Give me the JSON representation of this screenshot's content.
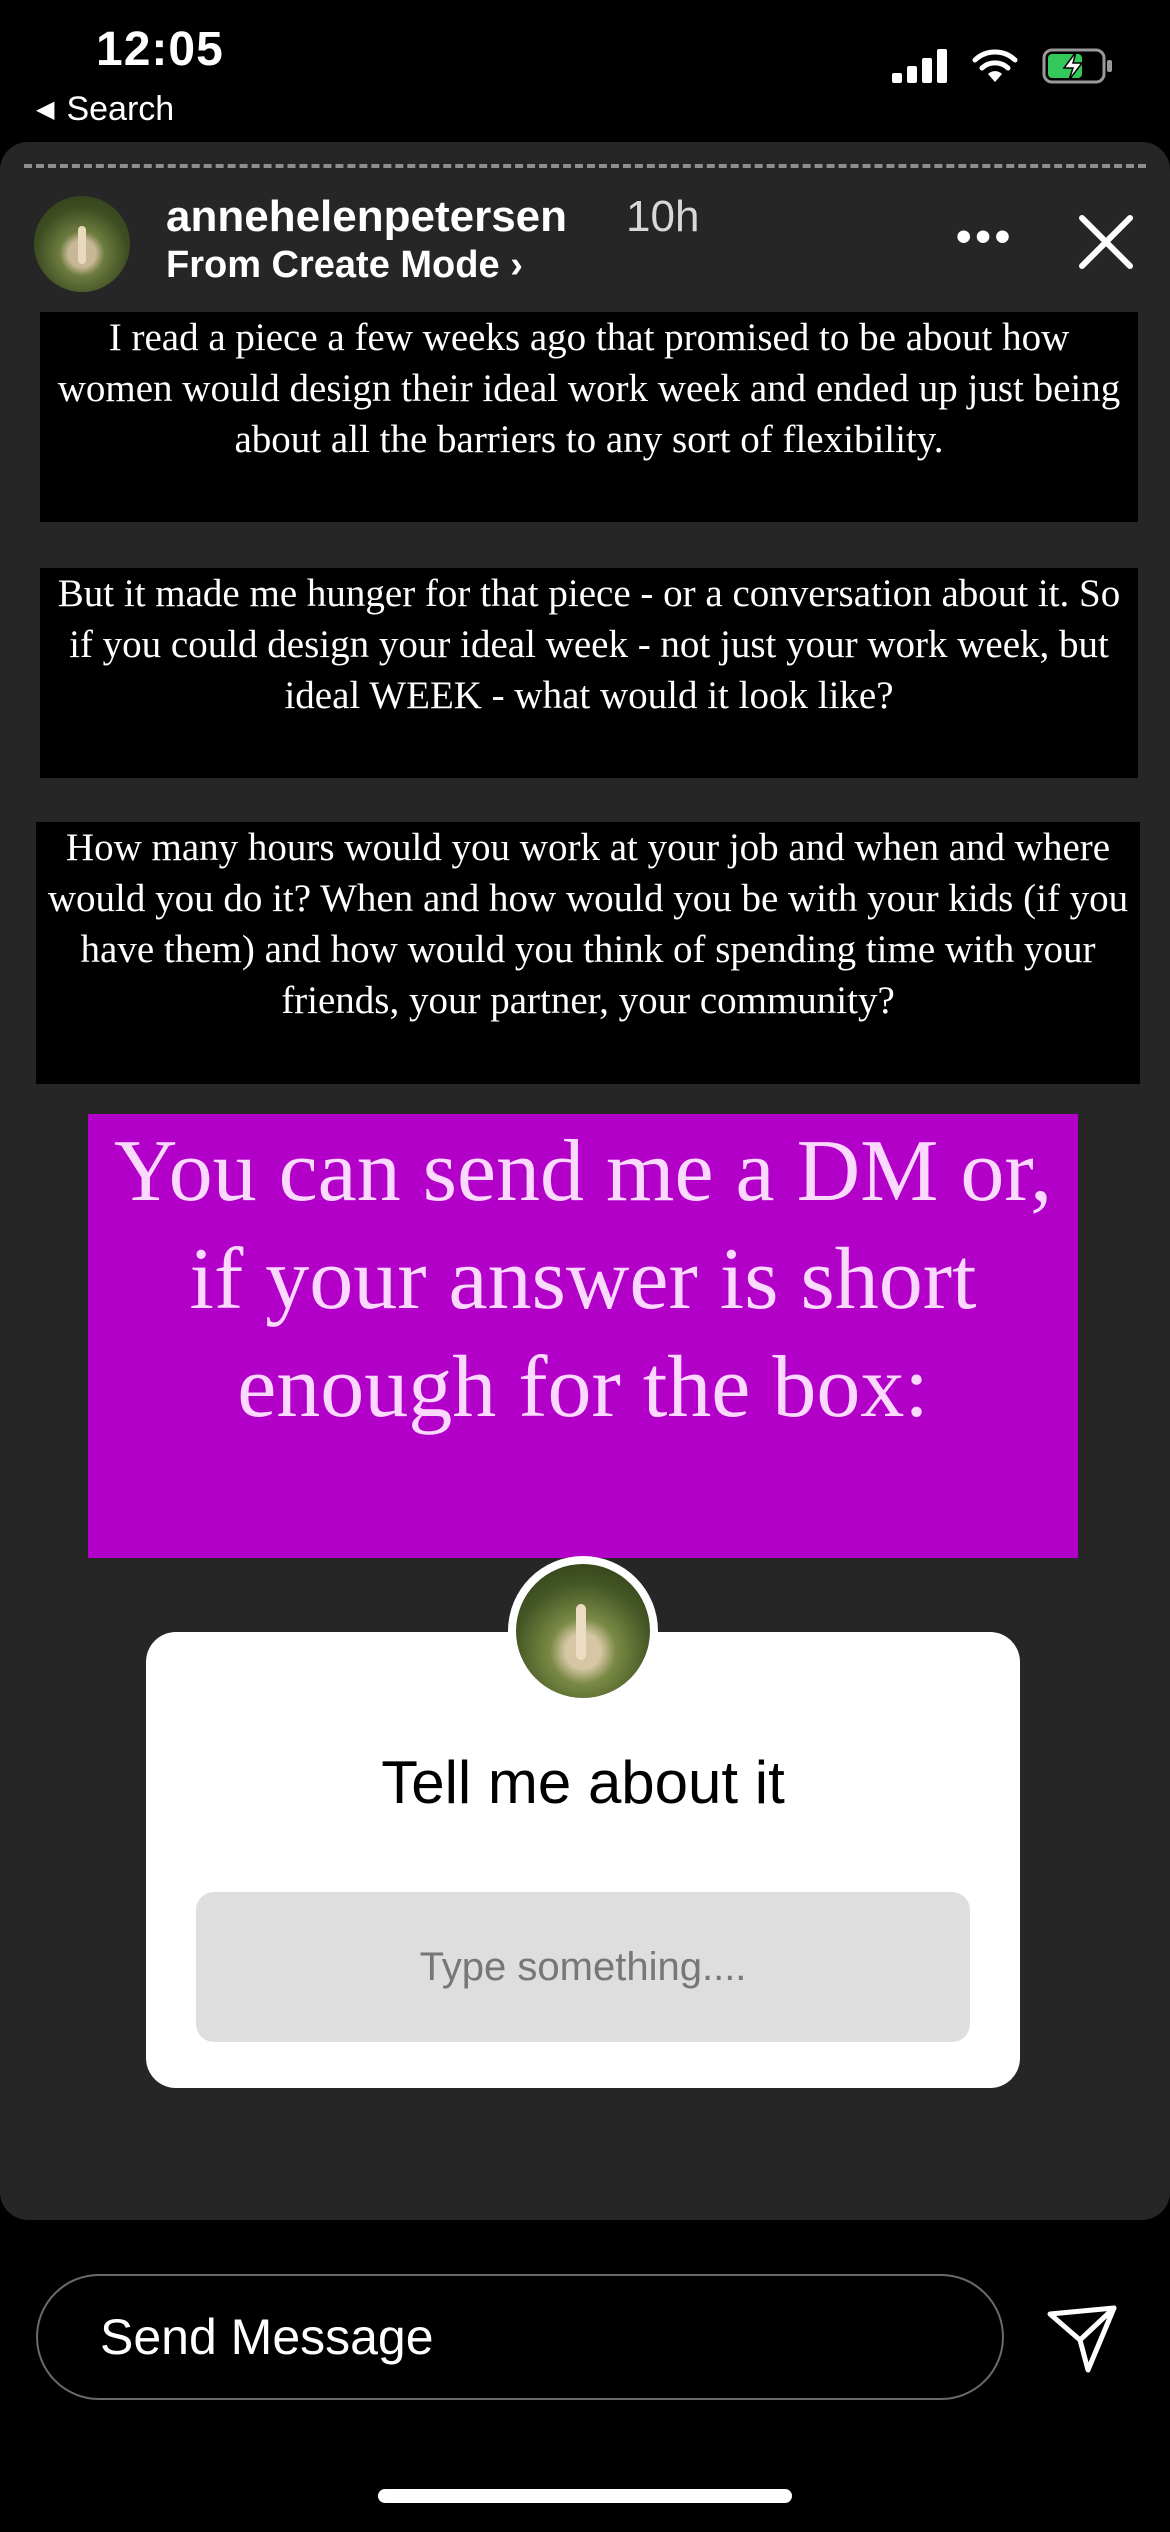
{
  "status_bar": {
    "time": "12:05",
    "back_label": "Search"
  },
  "story": {
    "username": "annehelenpetersen",
    "age": "10h",
    "subtitle": "From Create Mode",
    "subtitle_chevron": "›",
    "more_label": "•••",
    "text_blocks": [
      "I read a piece a few weeks ago that promised to be about how women would design their ideal work week and ended up just being about all the barriers to any sort of flexibility.",
      "But it made me hunger for that piece - or a conversation about it. So if you could design your ideal week - not just your work week, but ideal WEEK - what would it look like?",
      "How many hours would you work at your job and when and where would you do it? When and how would you be with your kids (if you have them) and how would you think of spending time with your friends, your partner, your community?"
    ],
    "highlight_text": "You can send me a DM or, if your answer is short enough for the box:",
    "question_box": {
      "title": "Tell me about it",
      "placeholder": "Type something...."
    }
  },
  "footer": {
    "send_message_label": "Send Message"
  },
  "colors": {
    "background": "#000000",
    "story_bg": "#262626",
    "highlight_bg": "#b200c9",
    "highlight_text": "#fbd9ff",
    "battery_green": "#34c759"
  }
}
